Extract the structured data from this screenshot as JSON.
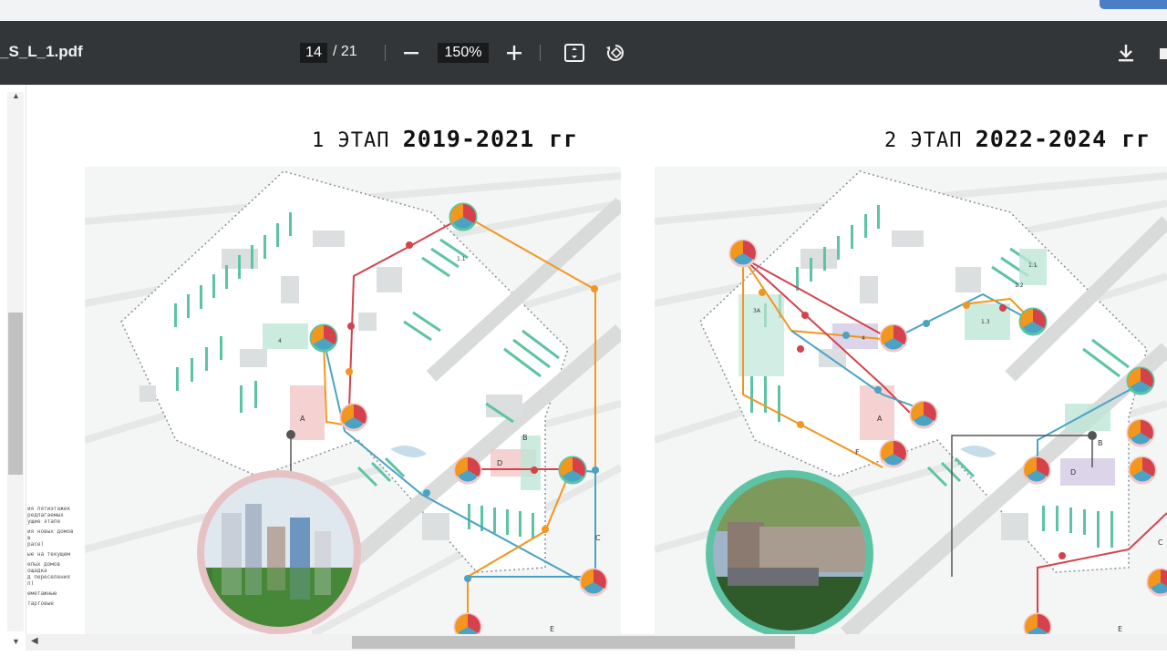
{
  "viewer": {
    "file_name": "_S_L_1.pdf",
    "current_page": "14",
    "total_pages": "/ 21",
    "zoom": "150%"
  },
  "icons": {
    "zoom_out": "minus-icon",
    "zoom_in": "plus-icon",
    "fit": "fit-to-page-icon",
    "rotate": "rotate-icon",
    "download": "download-icon",
    "print": "print-icon"
  },
  "stages": [
    {
      "prefix": "1 ЭТАП",
      "years": "2019-2021 гг"
    },
    {
      "prefix": "2 ЭТАП",
      "years": "2022-2024 гг"
    }
  ],
  "map_labels": {
    "stage1": [
      "A",
      "B",
      "C",
      "D",
      "E",
      "1.1",
      "4"
    ],
    "stage2": [
      "A",
      "B",
      "C",
      "D",
      "E",
      "F",
      "1.1",
      "1.2",
      "1.3",
      "3A",
      "4"
    ]
  },
  "legend": [
    "ия пятиэтажек\nредлагаемых\nущие этапе",
    "ия новых домов\nв\nрасе)",
    "ые на текущем",
    "елых домов\nощадка\nд переселения\nп)",
    "еметажные",
    "тартовые"
  ],
  "colors": {
    "teal": "#5cc4a4",
    "orange": "#f2961e",
    "red": "#d5424b",
    "blue": "#4aa3c4",
    "toolbar": "#323639"
  }
}
